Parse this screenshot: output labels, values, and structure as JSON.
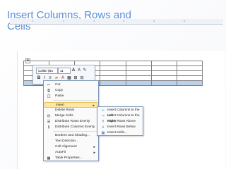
{
  "slide": {
    "title": "Insert Columns, Rows and Cells"
  },
  "ruler": {
    "marks": [
      "1",
      "2",
      "3",
      "4",
      "5",
      "6"
    ]
  },
  "minibar": {
    "font": "Calibri (Bo",
    "size": "11"
  },
  "context_menu": {
    "items": [
      {
        "label": "Cut",
        "icon": "scissors-icon"
      },
      {
        "label": "Copy",
        "icon": "copy-icon"
      },
      {
        "label": "Paste",
        "icon": "paste-icon"
      },
      {
        "label": "Insert",
        "icon": "none",
        "submenu": true
      },
      {
        "label": "Delete Rows",
        "icon": "none"
      },
      {
        "label": "Merge Cells",
        "icon": "merge-cells-icon"
      },
      {
        "label": "Distribute Rows Evenly",
        "icon": "distribute-rows-icon"
      },
      {
        "label": "Distribute Columns Evenly",
        "icon": "distribute-columns-icon"
      },
      {
        "label": "Borders and Shading...",
        "icon": "none"
      },
      {
        "label": "Text Direction...",
        "icon": "none"
      },
      {
        "label": "Cell Alignment",
        "icon": "none",
        "submenu": true
      },
      {
        "label": "AutoFit",
        "icon": "none",
        "submenu": true
      },
      {
        "label": "Table Properties...",
        "icon": "table-properties-icon"
      }
    ]
  },
  "insert_submenu": {
    "items": [
      {
        "label": "Insert Columns to the Left",
        "icon": "insert-columns-left-icon"
      },
      {
        "label": "Insert Columns to the Right",
        "icon": "insert-columns-right-icon"
      },
      {
        "label": "Insert Rows Above",
        "icon": "insert-rows-above-icon"
      },
      {
        "label": "Insert Rows Below",
        "icon": "insert-rows-below-icon"
      },
      {
        "label": "Insert Cells...",
        "icon": "insert-cells-icon"
      }
    ]
  }
}
